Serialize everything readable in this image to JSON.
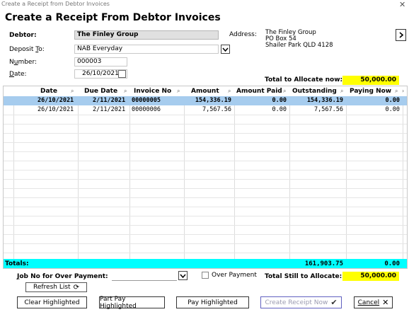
{
  "window": {
    "title": "Create a Receipt from Debtor Invoices"
  },
  "heading": "Create a Receipt From Debtor Invoices",
  "form": {
    "debtor_label": "Debtor:",
    "debtor_value": "The Finley Group",
    "deposit_label": "Deposit To:",
    "deposit_value": "NAB Everyday",
    "number_label": "Number:",
    "number_value": "000003",
    "date_label": "Date:",
    "date_value": "26/10/2021",
    "address_label": "Address:",
    "address_lines": [
      "The Finley Group",
      "PO Box 54",
      "Shailer Park QLD 4128"
    ],
    "total_allocate_label": "Total to Allocate now:",
    "total_allocate_value": "50,000.00"
  },
  "table": {
    "columns": [
      "Date",
      "Due Date",
      "Invoice No",
      "Amount",
      "Amount Paid",
      "Outstanding",
      "Paying Now"
    ],
    "rows": [
      [
        "26/10/2021",
        "2/11/2021",
        "00000005",
        "154,336.19",
        "0.00",
        "154,336.19",
        "0.00"
      ],
      [
        "26/10/2021",
        "2/11/2021",
        "00000006",
        "7,567.56",
        "0.00",
        "7,567.56",
        "0.00"
      ]
    ],
    "totals_label": "Totals:",
    "totals_outstanding": "161,903.75",
    "totals_paying": "0.00"
  },
  "footer": {
    "job_label": "Job No for Over Payment:",
    "over_payment_label": "Over Payment",
    "still_label": "Total Still to Allocate:",
    "still_value": "50,000.00",
    "refresh_label": "Refresh List",
    "clear_label": "Clear Highlighted",
    "part_pay_label": "Part Pay Highlighted",
    "pay_label": "Pay Highlighted",
    "create_label": "Create Receipt Now",
    "cancel_label": "Cancel"
  },
  "colors": {
    "highlight": "#a6ccee",
    "totals_bar": "#00ffff",
    "yellow": "#ffff00"
  }
}
